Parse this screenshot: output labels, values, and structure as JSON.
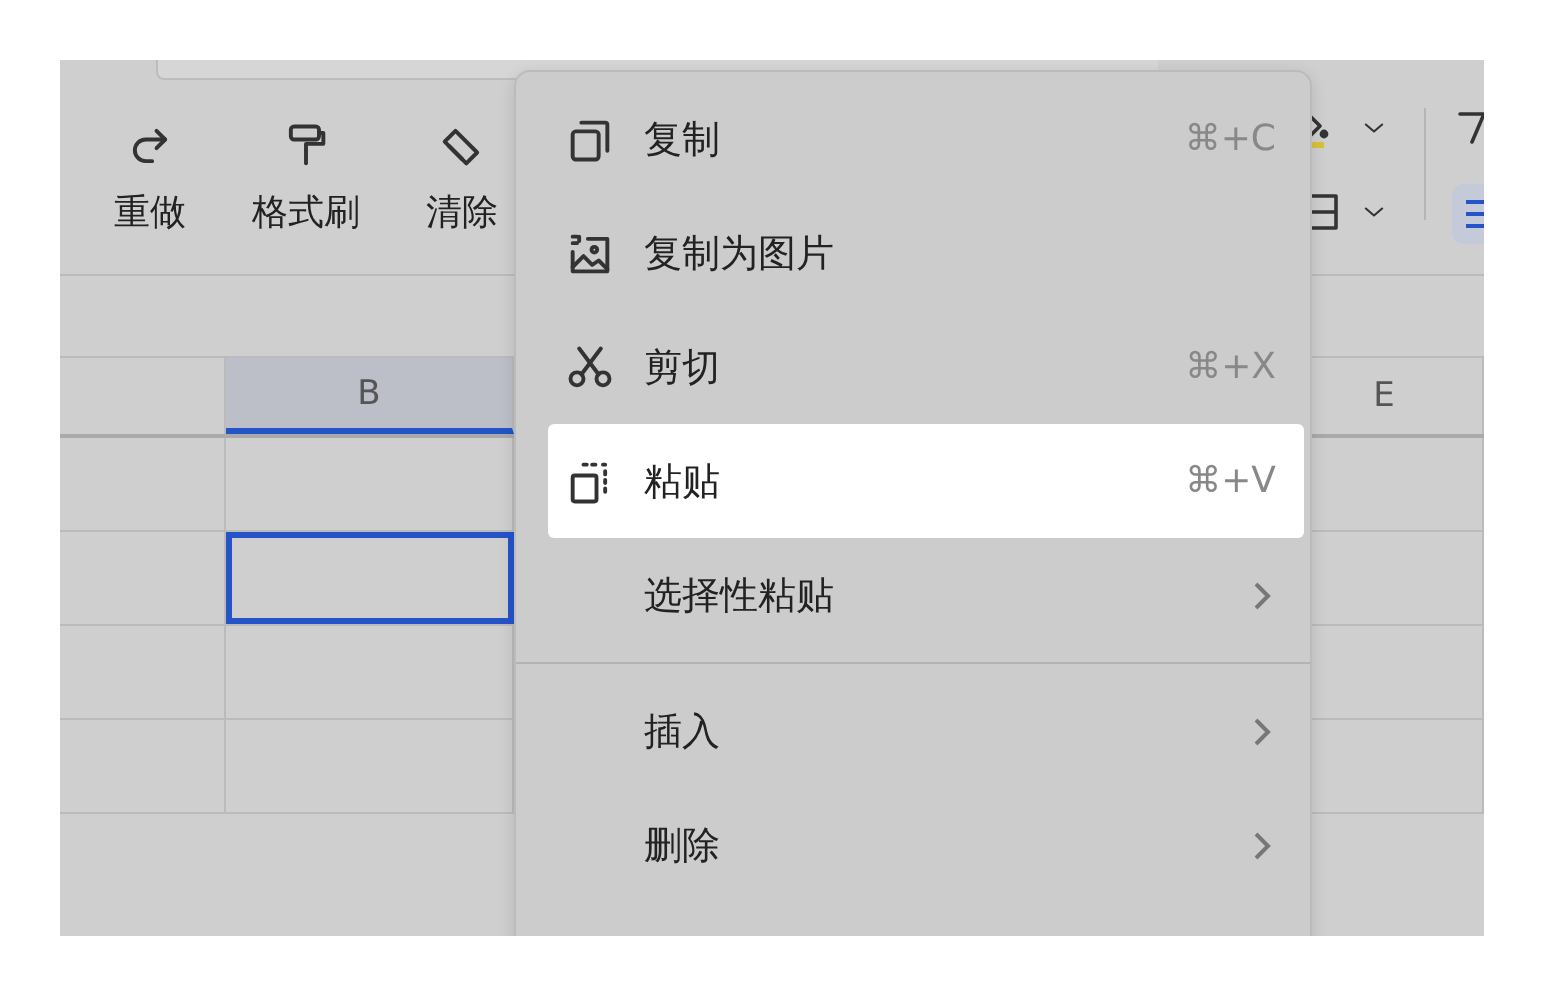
{
  "toolbar": {
    "buttons": [
      {
        "label": "重做"
      },
      {
        "label": "格式刷"
      },
      {
        "label": "清除"
      }
    ]
  },
  "sheet": {
    "columns": [
      {
        "label": "B",
        "selected": true
      },
      {
        "label": "E",
        "selected": false
      }
    ],
    "rows": [
      {
        "selected": false
      },
      {
        "selected": true
      },
      {
        "selected": false
      },
      {
        "selected": false
      }
    ]
  },
  "context_menu": {
    "items": [
      {
        "kind": "item",
        "label": "复制",
        "shortcut": "⌘+C",
        "submenu": false,
        "selected": false
      },
      {
        "kind": "item",
        "label": "复制为图片",
        "submenu": false,
        "selected": false
      },
      {
        "kind": "item",
        "label": "剪切",
        "shortcut": "⌘+X",
        "submenu": false,
        "selected": false
      },
      {
        "kind": "item",
        "label": "粘贴",
        "shortcut": "⌘+V",
        "submenu": false,
        "selected": true
      },
      {
        "kind": "item",
        "label": "选择性粘贴",
        "submenu": true,
        "selected": false
      },
      {
        "kind": "divider"
      },
      {
        "kind": "item",
        "label": "插入",
        "submenu": true,
        "selected": false
      },
      {
        "kind": "item",
        "label": "删除",
        "submenu": true,
        "selected": false
      }
    ]
  }
}
